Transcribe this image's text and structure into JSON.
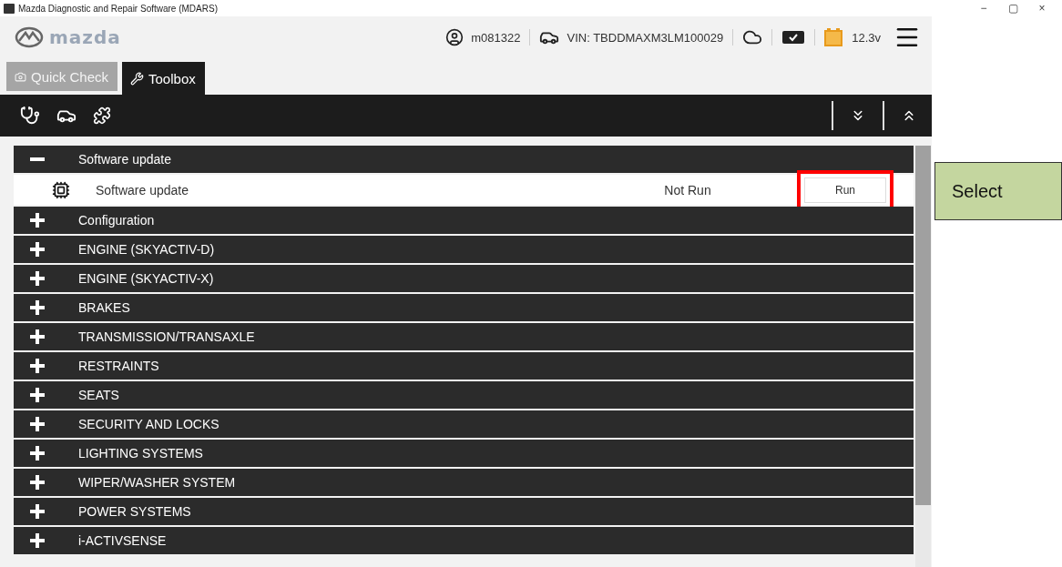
{
  "window": {
    "title": "Mazda Diagnostic and Repair Software (MDARS)",
    "controls": [
      "−",
      "▢",
      "×"
    ]
  },
  "header": {
    "brand": "mazda",
    "user": "m081322",
    "vin": "VIN: TBDDMAXM3LM100029",
    "voltage": "12.3v"
  },
  "tabs": [
    {
      "label": "Quick Check",
      "selected": false,
      "kind": "camera"
    },
    {
      "label": "Toolbox",
      "selected": true,
      "kind": "tools"
    }
  ],
  "groups": [
    {
      "label": "Software update",
      "expanded": true,
      "children": [
        {
          "label": "Software update",
          "status": "Not Run",
          "button": "Run",
          "highlighted": true
        }
      ]
    },
    {
      "label": "Configuration",
      "expanded": false
    },
    {
      "label": "ENGINE (SKYACTIV-D)",
      "expanded": false
    },
    {
      "label": "ENGINE (SKYACTIV-X)",
      "expanded": false
    },
    {
      "label": "BRAKES",
      "expanded": false
    },
    {
      "label": "TRANSMISSION/TRANSAXLE",
      "expanded": false
    },
    {
      "label": "RESTRAINTS",
      "expanded": false
    },
    {
      "label": "SEATS",
      "expanded": false
    },
    {
      "label": "SECURITY AND LOCKS",
      "expanded": false
    },
    {
      "label": "LIGHTING SYSTEMS",
      "expanded": false
    },
    {
      "label": "WIPER/WASHER SYSTEM",
      "expanded": false
    },
    {
      "label": "POWER SYSTEMS",
      "expanded": false
    },
    {
      "label": "i-ACTIVSENSE",
      "expanded": false
    }
  ],
  "callout": {
    "label": "Select"
  }
}
